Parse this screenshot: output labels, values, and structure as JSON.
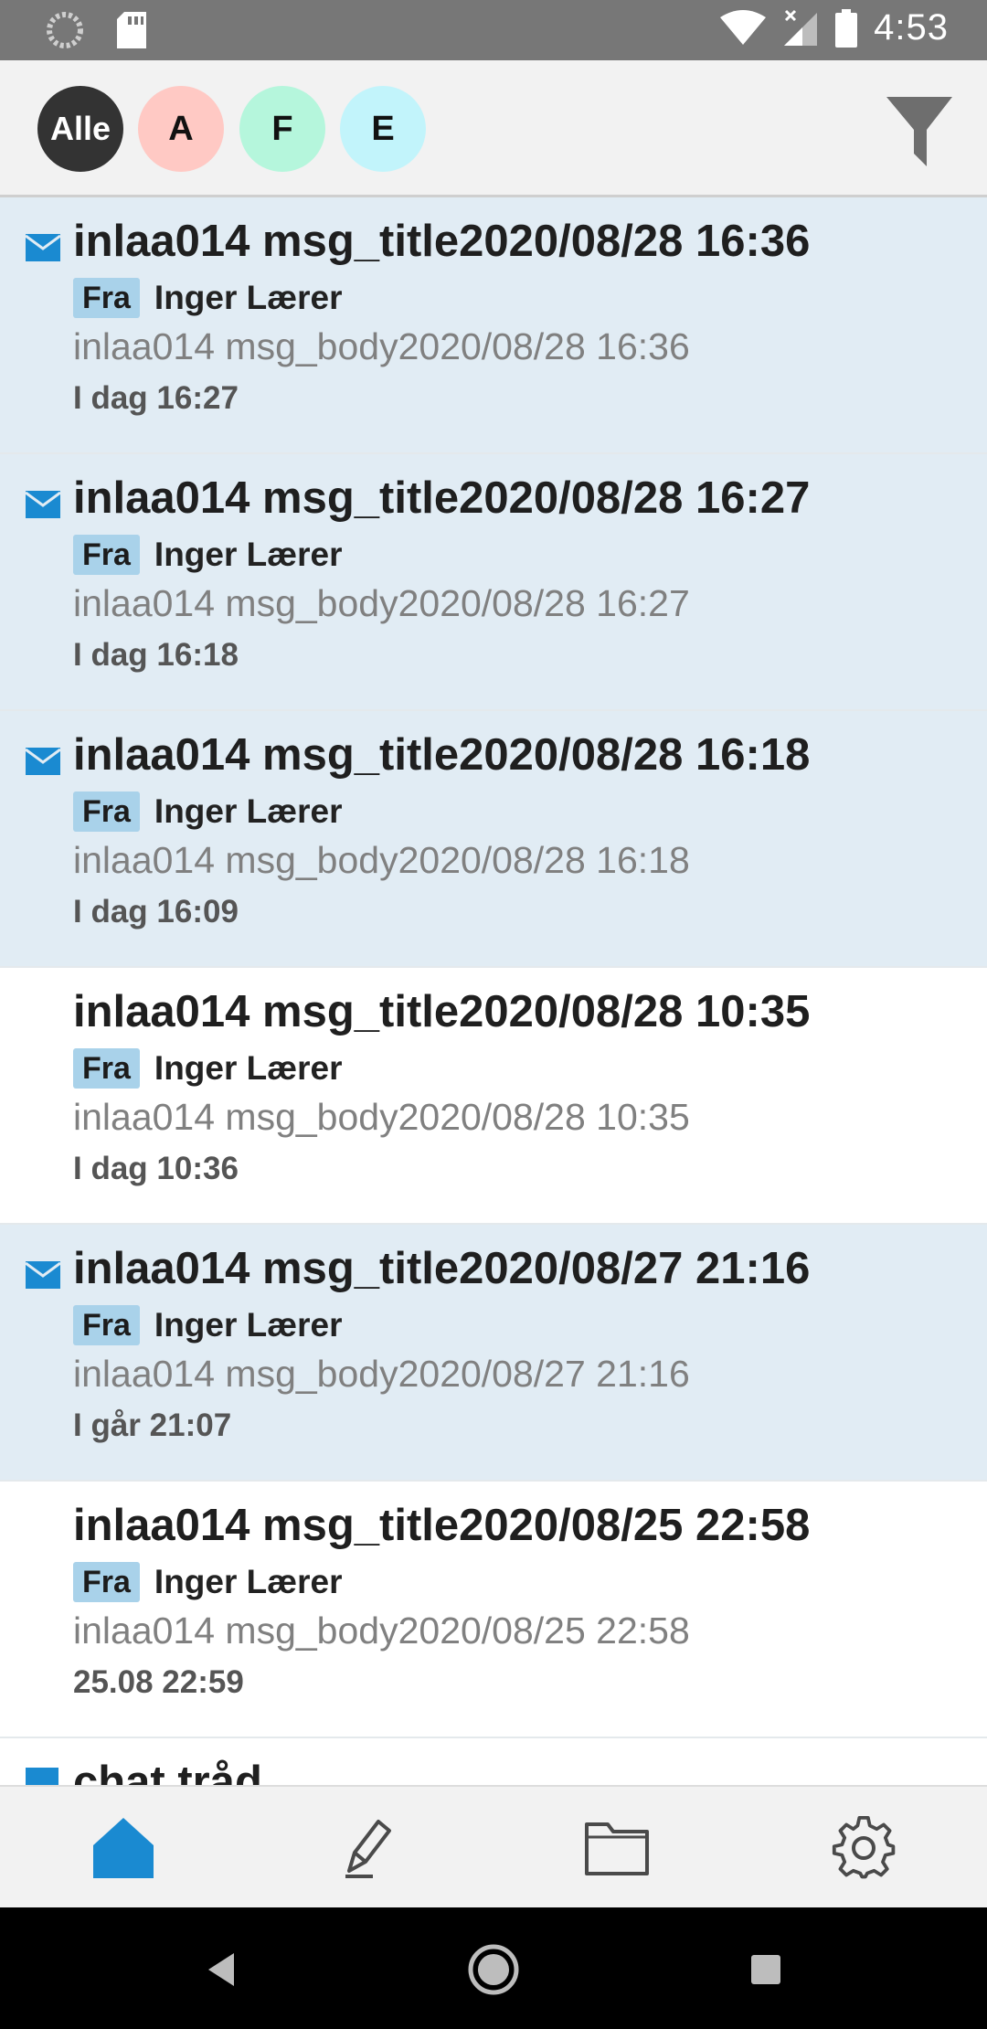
{
  "status_bar": {
    "time": "4:53",
    "icons": [
      "sync-icon",
      "sd-card-icon",
      "wifi-icon",
      "signal-icon",
      "battery-icon"
    ]
  },
  "filters": {
    "chips": [
      {
        "label": "Alle",
        "color": "#333333",
        "selected": true
      },
      {
        "label": "A",
        "color": "#ffc9c4"
      },
      {
        "label": "F",
        "color": "#b5f6dc"
      },
      {
        "label": "E",
        "color": "#c2f4fb"
      }
    ],
    "filter_icon": "funnel-icon"
  },
  "messages": [
    {
      "title": "inlaa014 msg_title2020/08/28 16:36",
      "from_label": "Fra",
      "sender": "Inger Lærer",
      "body": "inlaa014 msg_body2020/08/28 16:36",
      "time": "I dag 16:27",
      "unread": true
    },
    {
      "title": "inlaa014 msg_title2020/08/28 16:27",
      "from_label": "Fra",
      "sender": "Inger Lærer",
      "body": "inlaa014 msg_body2020/08/28 16:27",
      "time": "I dag 16:18",
      "unread": true
    },
    {
      "title": "inlaa014 msg_title2020/08/28 16:18",
      "from_label": "Fra",
      "sender": "Inger Lærer",
      "body": "inlaa014 msg_body2020/08/28 16:18",
      "time": "I dag 16:09",
      "unread": true
    },
    {
      "title": "inlaa014 msg_title2020/08/28 10:35",
      "from_label": "Fra",
      "sender": "Inger Lærer",
      "body": "inlaa014 msg_body2020/08/28 10:35",
      "time": "I dag 10:36",
      "unread": false
    },
    {
      "title": "inlaa014 msg_title2020/08/27 21:16",
      "from_label": "Fra",
      "sender": "Inger Lærer",
      "body": "inlaa014 msg_body2020/08/27 21:16",
      "time": "I går 21:07",
      "unread": true
    },
    {
      "title": "inlaa014 msg_title2020/08/25 22:58",
      "from_label": "Fra",
      "sender": "Inger Lærer",
      "body": "inlaa014 msg_body2020/08/25 22:58",
      "time": "25.08 22:59",
      "unread": false
    },
    {
      "title": "chat tråd",
      "unread": true
    }
  ],
  "bottom_nav": [
    {
      "icon": "home-icon",
      "active": true
    },
    {
      "icon": "pencil-icon"
    },
    {
      "icon": "folder-icon"
    },
    {
      "icon": "gear-icon"
    }
  ],
  "colors": {
    "accent": "#1a8ad1",
    "unread_bg": "#e1ecf4",
    "fra_badge": "#a9d2ea"
  }
}
